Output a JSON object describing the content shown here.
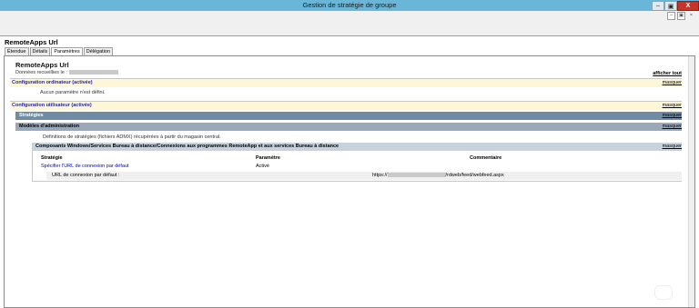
{
  "window": {
    "title": "Gestion de stratégie de groupe",
    "buttons": {
      "minimize": "–",
      "maximize": "▣",
      "close": "X"
    },
    "inner_buttons": {
      "minimize": "–",
      "restore": "▣",
      "close": "×"
    }
  },
  "panel": {
    "title": "RemoteApps Url",
    "tabs": [
      "Étendue",
      "Détails",
      "Paramètres",
      "Délégation"
    ],
    "active_tab": "Paramètres"
  },
  "report": {
    "title": "RemoteApps Url",
    "collected_label": "Données recueillies le :",
    "show_all": "afficher tout",
    "computer_config": {
      "label": "Configuration ordinateur (activée)",
      "hide": "masquer",
      "no_settings": "Aucun paramètre n'est défini."
    },
    "user_config": {
      "label": "Configuration utilisateur (activée)",
      "hide": "masquer",
      "strategies": {
        "label": "Stratégies",
        "hide": "masquer"
      },
      "admin_templates": {
        "label": "Modèles d'administration",
        "hide": "masquer",
        "description": "Définitions de stratégies (fichiers ADMX) récupérées à partir du magasin central."
      },
      "component": {
        "label": "Composants Windows/Services Bureau à distance/Connexions aux programmes RemoteApp et aux services Bureau à distance",
        "hide": "masquer",
        "table": {
          "headers": [
            "Stratégie",
            "Paramètre",
            "Commentaire"
          ],
          "policy_name": "Spécifier l'URL de connexion par défaut",
          "policy_value": "Activé",
          "sub_label": "URL de connexion par défaut :",
          "url_prefix": "https://",
          "url_suffix": "/rdweb/feed/webfeed.aspx"
        }
      }
    }
  }
}
